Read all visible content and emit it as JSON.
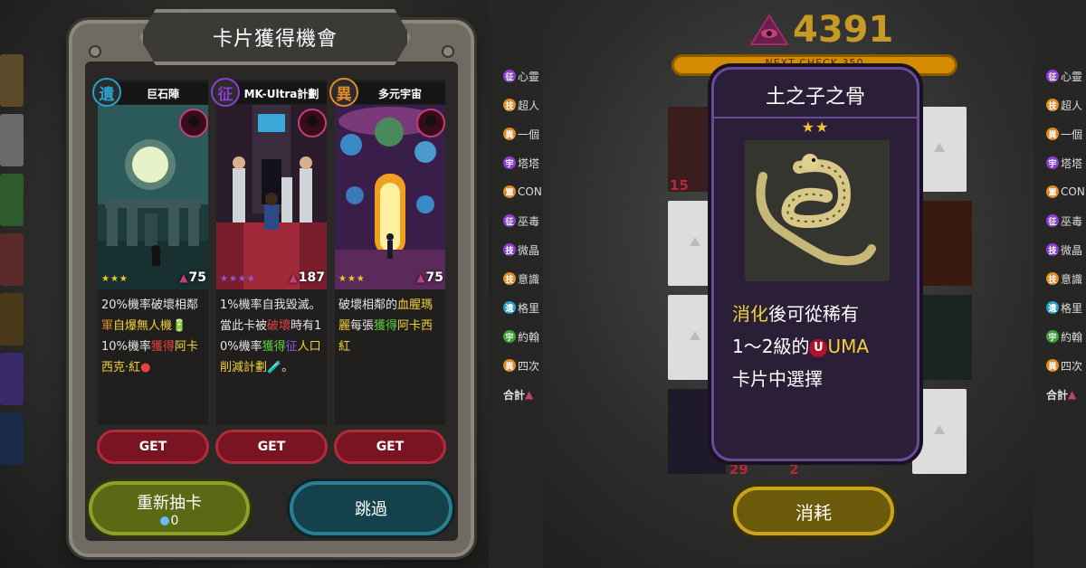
{
  "left": {
    "dialog_title": "卡片獲得機會",
    "cards": [
      {
        "type_glyph": "遺",
        "type_color": "#2aa0c8",
        "name": "巨石陣",
        "stars": "★★★",
        "stars_color": "#f2c230",
        "power": "75",
        "desc_html": "20%機率破壞相鄰<span style=\"color:#e08a2a\">軍</span><span style=\"color:#f1d23a\">自爆無人機</span>🔋<br>10%機率<span style=\"color:#e94040\">獲得</span><span style=\"color:#f1d23a\">阿卡西克‧紅</span><span style=\"color:#e94040\">●</span>",
        "get_label": "GET"
      },
      {
        "type_glyph": "征",
        "type_color": "#8a3fd1",
        "name": "MK-Ultra計劃",
        "stars": "★★★★",
        "stars_color": "#8a5ae0",
        "power": "187",
        "desc_html": "1%機率自我毀滅。當此卡被<span style=\"color:#e94040\">破壞</span>時有10%機率<span style=\"color:#5ad23a\">獲得</span><span style=\"color:#8a5ae0\">征</span><span style=\"color:#f1d23a\">人口削減計劃</span>🧪。",
        "get_label": "GET"
      },
      {
        "type_glyph": "異",
        "type_color": "#e08a2a",
        "name": "多元宇宙",
        "stars": "★★★",
        "stars_color": "#f2c230",
        "power": "75",
        "desc_html": "破壞相鄰的<span style=\"color:#f1d23a\">血腥瑪麗</span>每張<span style=\"color:#5ad23a\">獲得</span><span style=\"color:#f1d23a\">阿卡西紅</span>",
        "get_label": "GET"
      }
    ],
    "reroll_label": "重新抽卡",
    "reroll_cost": "0",
    "skip_label": "跳過",
    "side_list": [
      {
        "icon": "征",
        "color": "#8a3fd1",
        "text": "心靈"
      },
      {
        "icon": "技",
        "color": "#e08a2a",
        "text": "超人"
      },
      {
        "icon": "異",
        "color": "#e08a2a",
        "text": "一個"
      },
      {
        "icon": "宇",
        "color": "#8a3fd1",
        "text": "塔塔"
      },
      {
        "icon": "軍",
        "color": "#e08a2a",
        "text": "CON"
      },
      {
        "icon": "征",
        "color": "#8a3fd1",
        "text": "巫毒"
      },
      {
        "icon": "技",
        "color": "#8a3fd1",
        "text": "微晶"
      },
      {
        "icon": "技",
        "color": "#e08a2a",
        "text": "意識"
      },
      {
        "icon": "遺",
        "color": "#2aa0c8",
        "text": "格里"
      },
      {
        "icon": "宇",
        "color": "#3aa03a",
        "text": "約翰"
      },
      {
        "icon": "異",
        "color": "#e08a2a",
        "text": "四次"
      }
    ],
    "side_total": "合計"
  },
  "right": {
    "score": "4391",
    "next_check": "NEXT CHECK 350",
    "detail": {
      "title": "土之子之骨",
      "stars": "★★",
      "text_line1_hl": "消化",
      "text_line1": "後可從稀有",
      "text_line2_a": "1～2級的",
      "uma_badge": "U",
      "text_line2_b": "UMA",
      "text_line3": "卡片中選擇"
    },
    "mini_nums": [
      "15",
      "29",
      "2"
    ],
    "consume_label": "消耗",
    "side_list": [
      {
        "icon": "征",
        "color": "#8a3fd1",
        "text": "心靈"
      },
      {
        "icon": "技",
        "color": "#e08a2a",
        "text": "超人"
      },
      {
        "icon": "異",
        "color": "#e08a2a",
        "text": "一個"
      },
      {
        "icon": "宇",
        "color": "#8a3fd1",
        "text": "塔塔"
      },
      {
        "icon": "軍",
        "color": "#e08a2a",
        "text": "CON"
      },
      {
        "icon": "征",
        "color": "#8a3fd1",
        "text": "巫毒"
      },
      {
        "icon": "技",
        "color": "#8a3fd1",
        "text": "微晶"
      },
      {
        "icon": "技",
        "color": "#e08a2a",
        "text": "意識"
      },
      {
        "icon": "遺",
        "color": "#2aa0c8",
        "text": "格里"
      },
      {
        "icon": "宇",
        "color": "#3aa03a",
        "text": "約翰"
      },
      {
        "icon": "異",
        "color": "#e08a2a",
        "text": "四次"
      }
    ],
    "side_total": "合計"
  }
}
